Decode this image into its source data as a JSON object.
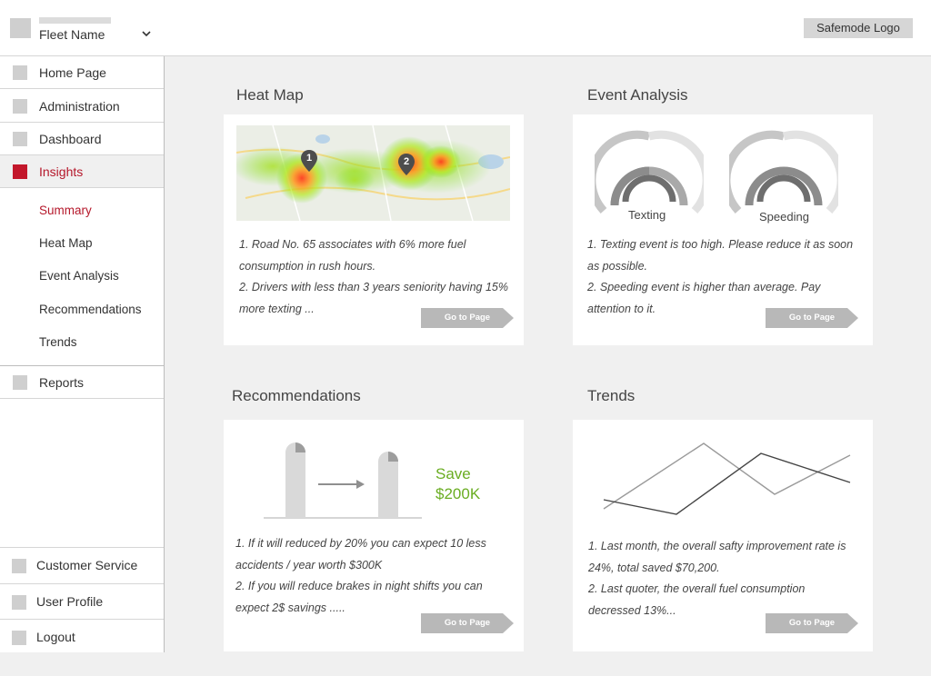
{
  "header": {
    "fleet_name": "Fleet Name",
    "logo_text": "Safemode Logo"
  },
  "sidebar": {
    "items": [
      {
        "label": "Home Page"
      },
      {
        "label": "Administration"
      },
      {
        "label": "Dashboard"
      },
      {
        "label": "Insights"
      }
    ],
    "sub_items": [
      {
        "label": "Summary"
      },
      {
        "label": "Heat Map"
      },
      {
        "label": "Event Analysis"
      },
      {
        "label": "Recommendations"
      },
      {
        "label": "Trends"
      }
    ],
    "reports": "Reports",
    "bottom_items": [
      {
        "label": "Customer Service"
      },
      {
        "label": "User Profile"
      },
      {
        "label": "Logout"
      }
    ]
  },
  "heat_map": {
    "title": "Heat Map",
    "pins": [
      "1",
      "2"
    ],
    "lines": [
      "1. Road No. 65 associates with 6% more fuel",
      "consumption in rush hours.",
      "2. Drivers with less than 3 years seniority having 15%",
      "more texting ..."
    ],
    "button": "Go to Page"
  },
  "event_analysis": {
    "title": "Event Analysis",
    "gauges": [
      {
        "label": "Texting"
      },
      {
        "label": "Speeding"
      }
    ],
    "lines": [
      "1. Texting event is too high. Please reduce it as soon",
      "as possible.",
      "2. Speeding event is higher than average. Pay",
      "attention to it."
    ],
    "button": "Go to Page"
  },
  "recommendations": {
    "title": "Recommendations",
    "save_line1": "Save",
    "save_line2": "$200K",
    "lines": [
      "1. If it will reduced by 20% you can expect 10 less",
      "accidents / year worth $300K",
      "2. If you will reduce brakes in night shifts you can",
      "expect 2$ savings ....."
    ],
    "button": "Go to Page"
  },
  "trends": {
    "title": "Trends",
    "lines": [
      "1. Last month, the overall safty improvement rate is",
      "24%, total saved $70,200.",
      "2. Last quoter, the overall fuel consumption",
      "decressed 13%..."
    ],
    "button": "Go to Page"
  },
  "colors": {
    "accent": "#b5182b",
    "save_green": "#6aad22",
    "button_gray": "#b8b8b8"
  }
}
